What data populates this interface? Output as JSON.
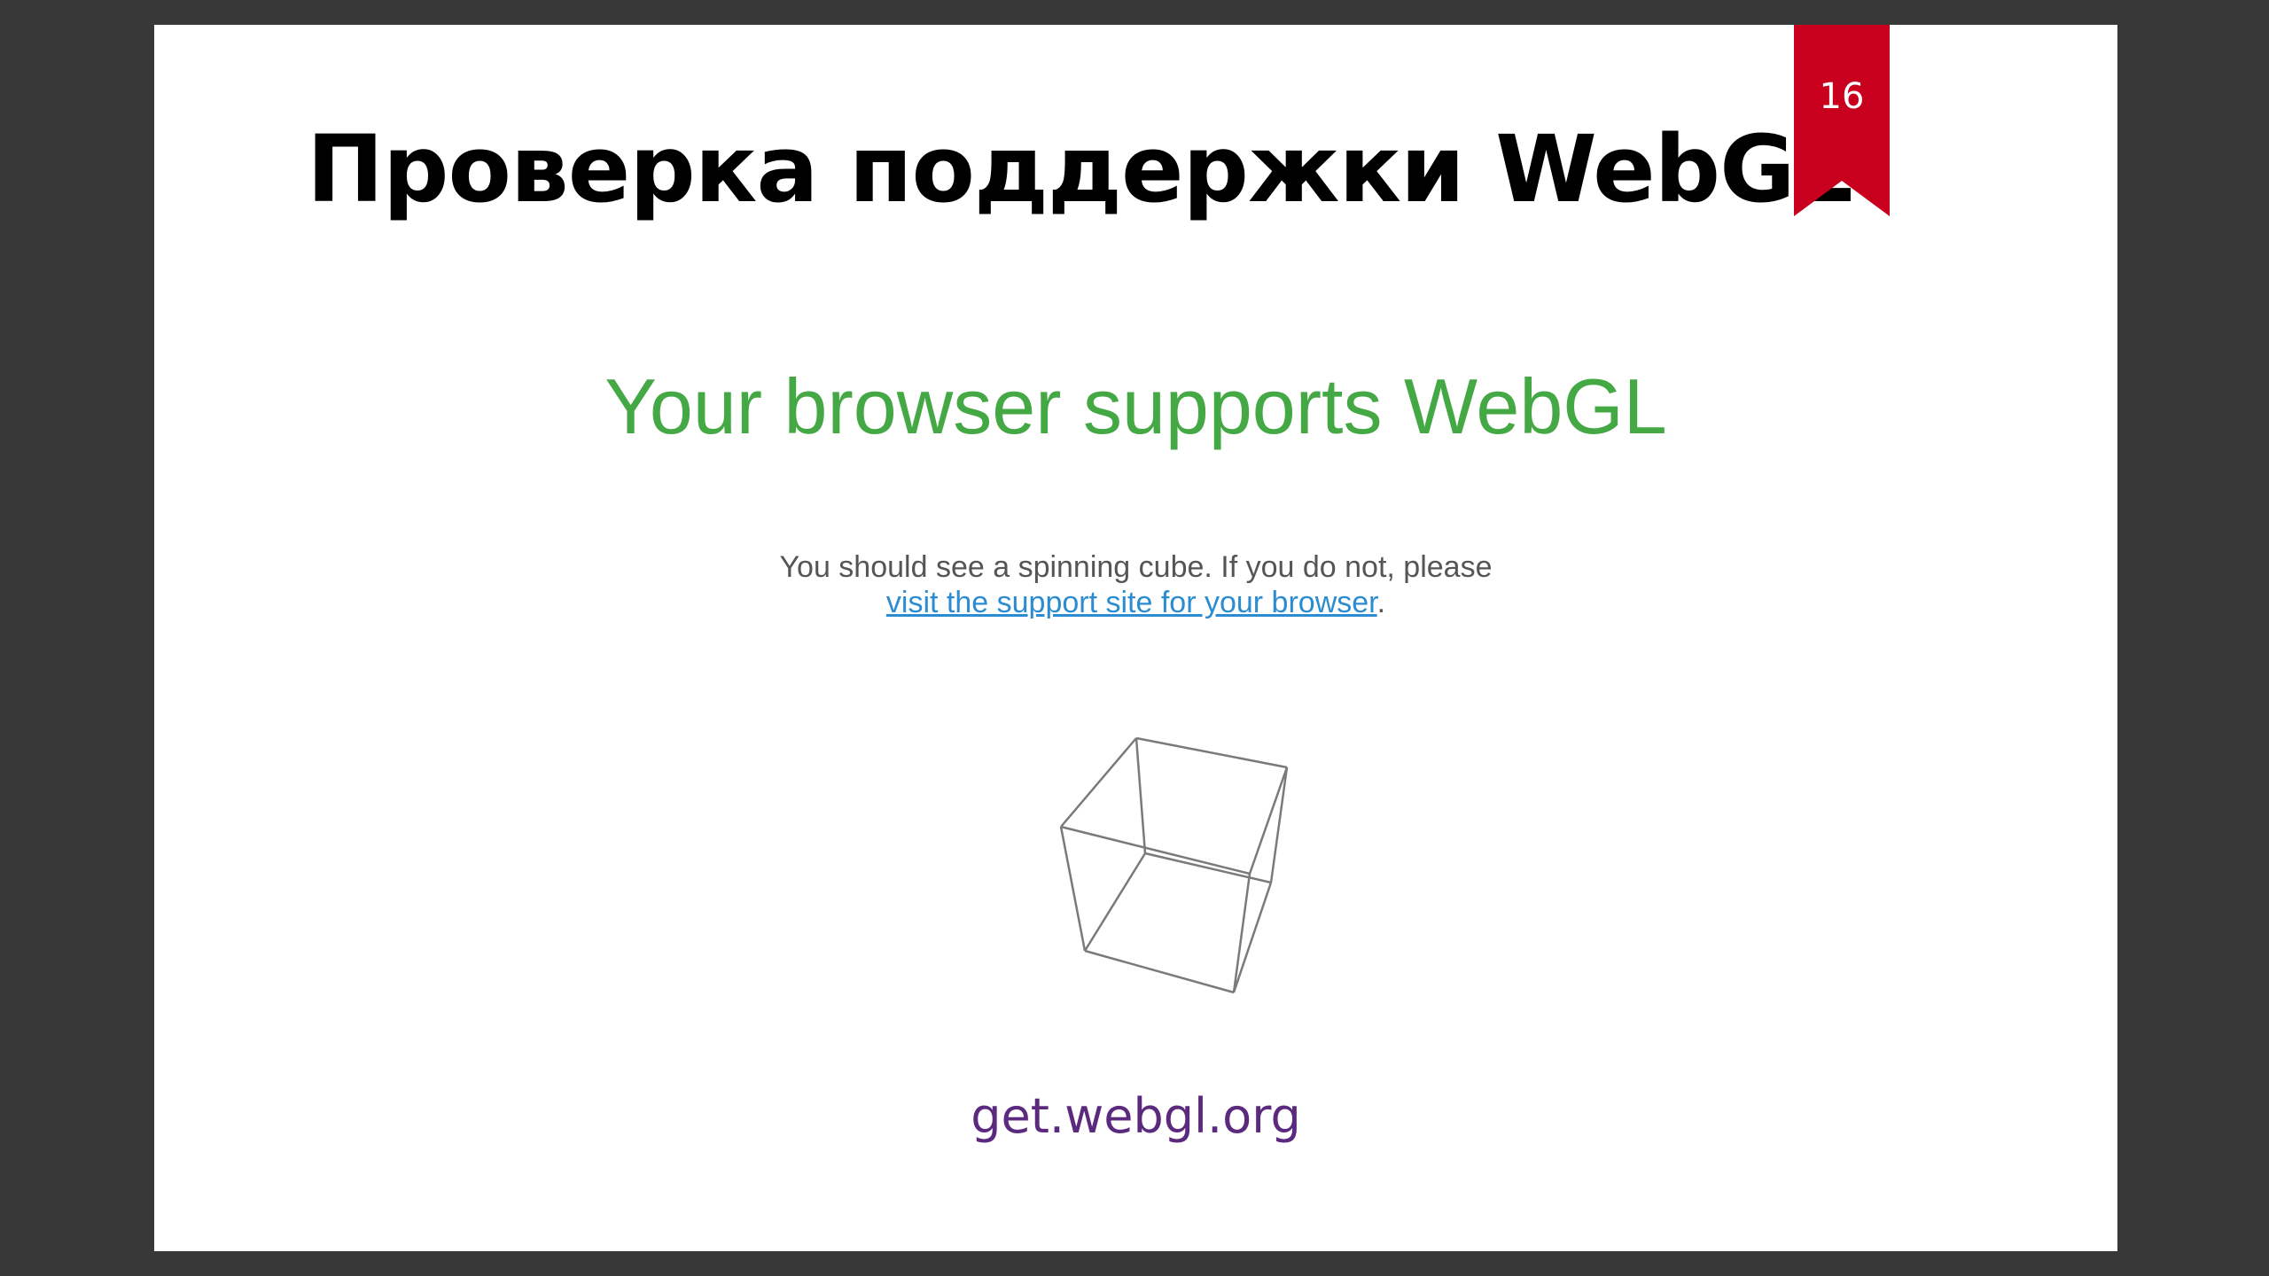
{
  "slide": {
    "title": "Проверка поддержки WebGL",
    "number": "16",
    "bookmark_color": "#c8001e",
    "embedded_page": {
      "heading": "Your browser supports WebGL",
      "note_text": "You should see a spinning cube. If you do not, please",
      "link_text": "visit the support site for your browser",
      "note_suffix": ".",
      "heading_color": "#44a845",
      "link_color": "#2b8cd1"
    },
    "footer_url": "get.webgl.org",
    "footer_color": "#5b2a7f"
  }
}
